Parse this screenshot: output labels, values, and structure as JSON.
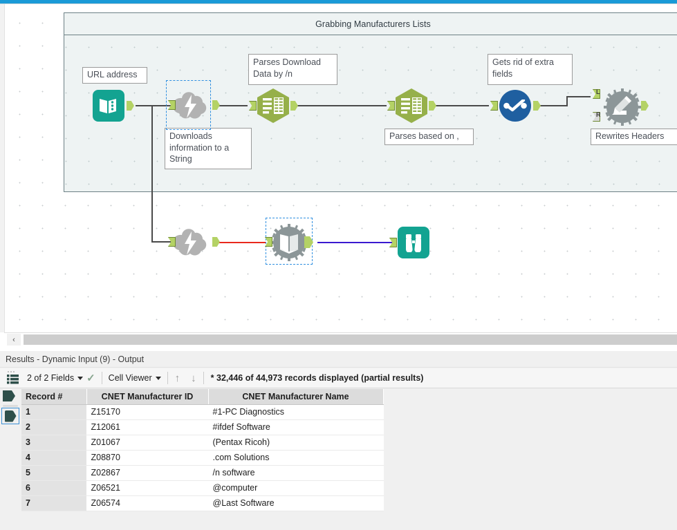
{
  "app": {
    "accent_blue": "#1a9ad7",
    "canvas_bg": "#ffffff",
    "container_bg": "#eef3f3"
  },
  "canvas": {
    "container": {
      "title": "Grabbing Manufacturers Lists"
    },
    "tools": [
      {
        "id": "text-input",
        "name": "URL address",
        "icon": "book-list-icon",
        "color": "#13a391",
        "selected": false
      },
      {
        "id": "download-top",
        "name": "Downloads information to a String",
        "icon": "cloud-lightning-icon",
        "color": "#a8a8a8",
        "selected": true
      },
      {
        "id": "text-to-columns-1",
        "name": "Parses Download Data by /n",
        "icon": "text-to-columns-icon",
        "color": "#96b04a",
        "selected": false
      },
      {
        "id": "text-to-columns-2",
        "name": "Parses based on ,",
        "icon": "text-to-columns-icon",
        "color": "#96b04a",
        "selected": false
      },
      {
        "id": "select",
        "name": "Gets rid of extra fields",
        "icon": "select-check-icon",
        "color": "#1f5fa0",
        "selected": false
      },
      {
        "id": "dynamic-rename",
        "name": "Rewrites Headers",
        "icon": "dynamic-rename-icon",
        "color": "#8c9698",
        "selected": false
      },
      {
        "id": "download-bottom",
        "name": "",
        "icon": "cloud-lightning-icon",
        "color": "#a8a8a8",
        "selected": false
      },
      {
        "id": "dynamic-input",
        "name": "",
        "icon": "dynamic-input-icon",
        "color": "#8c9698",
        "selected": true
      },
      {
        "id": "browse",
        "name": "",
        "icon": "binoculars-icon",
        "color": "#13a391",
        "selected": false
      }
    ],
    "annotations": [
      {
        "id": "ann-url",
        "text": "URL address"
      },
      {
        "id": "ann-download",
        "text": "Downloads information to a String"
      },
      {
        "id": "ann-parse-n",
        "text": "Parses Download Data by /n"
      },
      {
        "id": "ann-parse-c",
        "text": "Parses based on ,"
      },
      {
        "id": "ann-select",
        "text": "Gets rid of extra fields"
      },
      {
        "id": "ann-rename",
        "text": "Rewrites Headers"
      }
    ],
    "connector_labels": {
      "left_input": "L",
      "right_input": "R"
    },
    "connection_colors": {
      "default": "#4a4a4a",
      "error": "#e8291c",
      "selected": "#3a1ad0"
    },
    "scrollbar": {
      "left_arrow": "‹"
    }
  },
  "results": {
    "title": "Results - Dynamic Input (9) - Output",
    "toolbar": {
      "fields_label": "2 of 2 Fields",
      "viewer_label": "Cell Viewer",
      "up_arrow": "↑",
      "down_arrow": "↓",
      "check_glyph": "✓",
      "status": "* 32,446 of 44,973 records displayed (partial results)"
    },
    "table": {
      "columns": [
        "Record #",
        "CNET Manufacturer ID",
        "CNET Manufacturer Name"
      ],
      "rows": [
        [
          "1",
          "Z15170",
          "#1-PC Diagnostics"
        ],
        [
          "2",
          "Z12061",
          "#ifdef Software"
        ],
        [
          "3",
          "Z01067",
          "(Pentax Ricoh)"
        ],
        [
          "4",
          "Z08870",
          ".com Solutions"
        ],
        [
          "5",
          "Z02867",
          "/n software"
        ],
        [
          "6",
          "Z06521",
          "@computer"
        ],
        [
          "7",
          "Z06574",
          "@Last Software"
        ]
      ]
    }
  }
}
